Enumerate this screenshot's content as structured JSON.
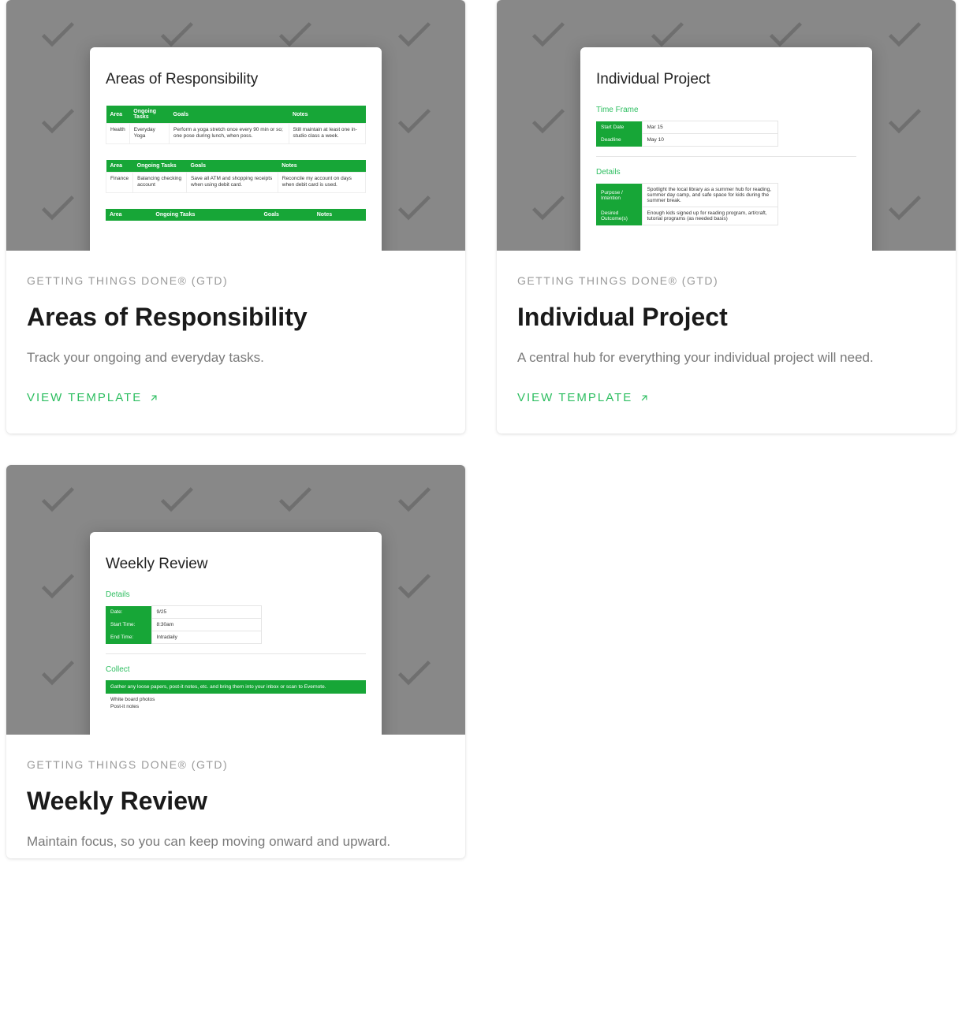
{
  "view_template_label": "VIEW TEMPLATE",
  "cards": [
    {
      "category": "GETTING THINGS DONE® (GTD)",
      "title": "Areas of Responsibility",
      "desc": "Track your ongoing and everyday tasks.",
      "preview": {
        "doc_title": "Areas of Responsibility",
        "columns": [
          "Area",
          "Ongoing Tasks",
          "Goals",
          "Notes"
        ],
        "rows": [
          [
            "Health",
            "Everyday Yoga",
            "Perform a yoga stretch once every 90 min or so; one pose during lunch, when poss.",
            "Still maintain at least one in-studio class a week."
          ],
          [
            "Finance",
            "Balancing checking account",
            "Save all ATM and shopping receipts when using debit card.",
            "Reconcile my account on days when debit card is used."
          ]
        ]
      }
    },
    {
      "category": "GETTING THINGS DONE® (GTD)",
      "title": "Individual Project",
      "desc": "A central hub for everything your individual project will need.",
      "preview": {
        "doc_title": "Individual Project",
        "time_frame_label": "Time Frame",
        "time_frame": [
          [
            "Start Date",
            "Mar 15"
          ],
          [
            "Deadline",
            "May 10"
          ]
        ],
        "details_label": "Details",
        "details": [
          [
            "Purpose / Intention",
            "Spotlight the local library as a summer hub for reading, summer day camp, and safe space for kids during the summer break."
          ],
          [
            "Desired Outcome(s)",
            "Enough kids signed up for reading program, art/craft, tutorial programs (as needed basis)"
          ]
        ]
      }
    },
    {
      "category": "GETTING THINGS DONE® (GTD)",
      "title": "Weekly Review",
      "desc": "Maintain focus, so you can keep moving onward and upward.",
      "preview": {
        "doc_title": "Weekly Review",
        "details_label": "Details",
        "details": [
          [
            "Date:",
            "9/25"
          ],
          [
            "Start Time:",
            "8:30am"
          ],
          [
            "End Time:",
            "Intradaily"
          ]
        ],
        "collect_label": "Collect",
        "collect_bar": "Gather any loose papers, post-it notes, etc. and bring them into your inbox or scan to Evernote.",
        "collect_items": "White board photos\nPost-it notes"
      }
    }
  ]
}
